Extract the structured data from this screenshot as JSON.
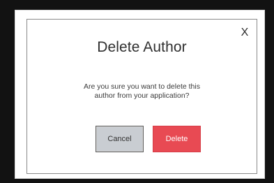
{
  "dialog": {
    "title": "Delete Author",
    "message_line1": "Are you sure you want to delete this",
    "message_line2": "author from your application?",
    "close_label": "X",
    "cancel_label": "Cancel",
    "delete_label": "Delete"
  },
  "colors": {
    "background": "#121212",
    "dialog_background": "#ffffff",
    "delete_button": "#e84a53",
    "cancel_button": "#c9cdd2"
  }
}
